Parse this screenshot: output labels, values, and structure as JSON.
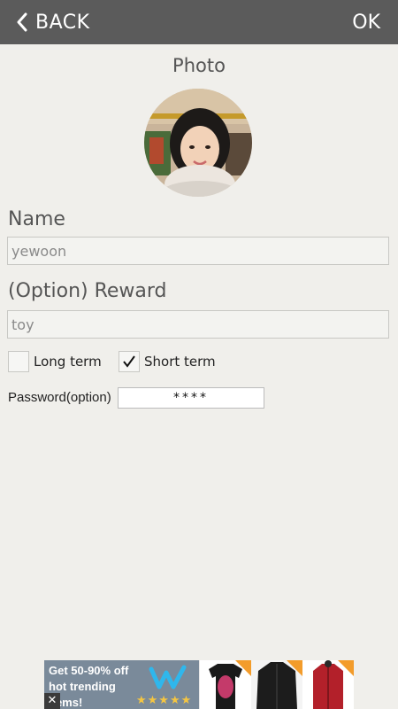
{
  "header": {
    "back_label": "BACK",
    "ok_label": "OK"
  },
  "photo": {
    "label": "Photo"
  },
  "name": {
    "label": "Name",
    "value": "yewoon"
  },
  "reward": {
    "label": "(Option) Reward",
    "value": "toy"
  },
  "term": {
    "long_label": "Long term",
    "long_checked": false,
    "short_label": "Short term",
    "short_checked": true
  },
  "password": {
    "label": "Password(option)",
    "value": "****"
  },
  "ad": {
    "text": "Get 50-90% off hot trending items!",
    "close_glyph": "✕",
    "stars": "★★★★★"
  },
  "colors": {
    "topbar": "#5b5b5b",
    "background": "#f0efeb",
    "ad_panel": "#7a8a9a",
    "wish_logo": "#2fb7ec",
    "ad_tag": "#f39c2b"
  },
  "icons": {
    "back": "chevron-left-icon",
    "check": "checkmark-icon",
    "ad_close": "close-icon",
    "ad_logo": "wish-logo-icon"
  }
}
